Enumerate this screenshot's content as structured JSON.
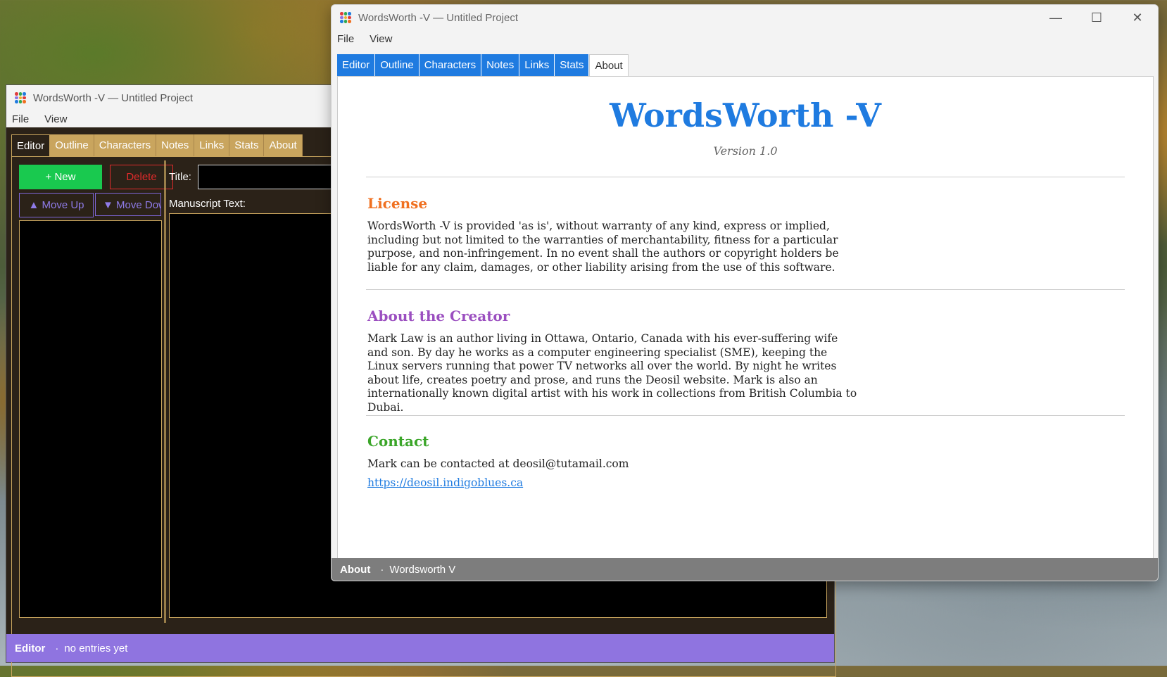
{
  "back_window": {
    "title": "WordsWorth -V — Untitled Project",
    "menu": [
      "File",
      "View"
    ],
    "tabs": [
      "Editor",
      "Outline",
      "Characters",
      "Notes",
      "Links",
      "Stats",
      "About"
    ],
    "buttons": {
      "new": "+ New",
      "delete": "Delete",
      "move_up": "▲ Move Up",
      "move_down": "▼ Move Down"
    },
    "labels": {
      "title": "Title:",
      "manuscript": "Manuscript Text:"
    },
    "status": {
      "section": "Editor",
      "sep": "·",
      "text": "no entries yet"
    }
  },
  "front_window": {
    "title": "WordsWorth -V — Untitled Project",
    "menu": [
      "File",
      "View"
    ],
    "tabs": [
      "Editor",
      "Outline",
      "Characters",
      "Notes",
      "Links",
      "Stats",
      "About"
    ],
    "about": {
      "app_name": "WordsWorth -V",
      "version": "Version 1.0",
      "license_heading": "License",
      "license_text": "WordsWorth -V is provided 'as is', without warranty of any kind, express or implied, including but not limited to the warranties of merchantability, fitness for a particular purpose, and non-infringement. In no event shall the authors or copyright holders be liable for any claim, damages, or other liability arising from the use of this software.",
      "creator_heading": "About the Creator",
      "creator_text": "Mark Law is an author living in Ottawa, Ontario, Canada with his ever-suffering wife and son. By day he works as a computer engineering specialist (SME), keeping the Linux servers running that power TV networks all over the world. By night he writes about life, creates poetry and prose, and runs the Deosil website. Mark is also an internationally known digital artist with his work in collections from British Columbia to Dubai.",
      "contact_heading": "Contact",
      "contact_text": "Mark can be contacted at deosil@tutamail.com",
      "link": "https://deosil.indigoblues.ca"
    },
    "status": {
      "section": "About",
      "sep": "·",
      "text": "Wordsworth V"
    }
  },
  "colors": {
    "license": "#f07020",
    "creator": "#9b4fc0",
    "contact": "#3aa528",
    "accent": "#1f7be0"
  }
}
